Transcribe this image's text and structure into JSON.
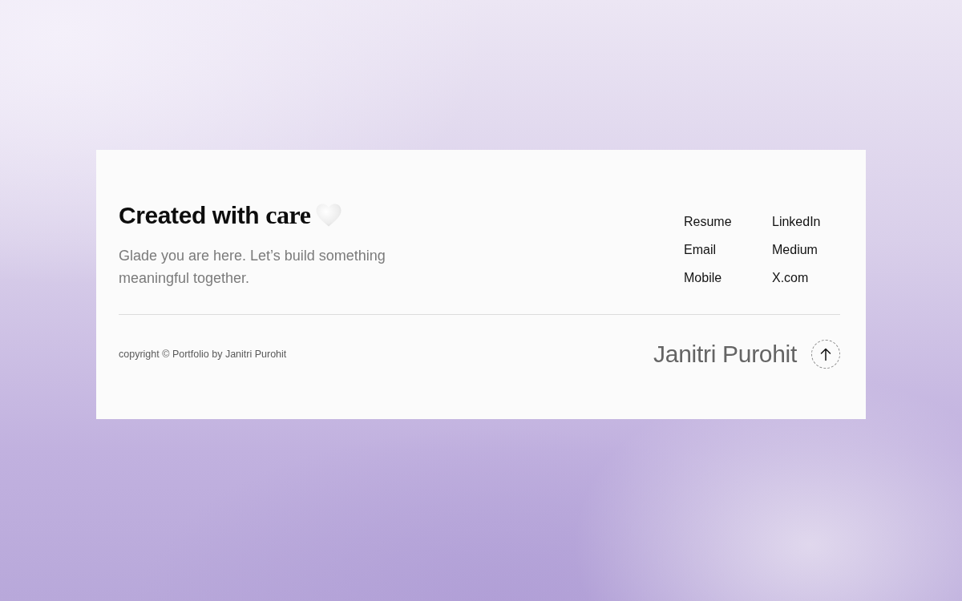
{
  "heading": {
    "text": "Created with",
    "accent": "care"
  },
  "tagline": "Glade you are here. Let’s build something meaningful together.",
  "links": [
    {
      "label": "Resume"
    },
    {
      "label": "LinkedIn"
    },
    {
      "label": "Email"
    },
    {
      "label": "Medium"
    },
    {
      "label": "Mobile"
    },
    {
      "label": "X.com"
    }
  ],
  "footer": {
    "copyright": "copyright © Portfolio by Janitri Purohit",
    "name": "Janitri Purohit"
  }
}
